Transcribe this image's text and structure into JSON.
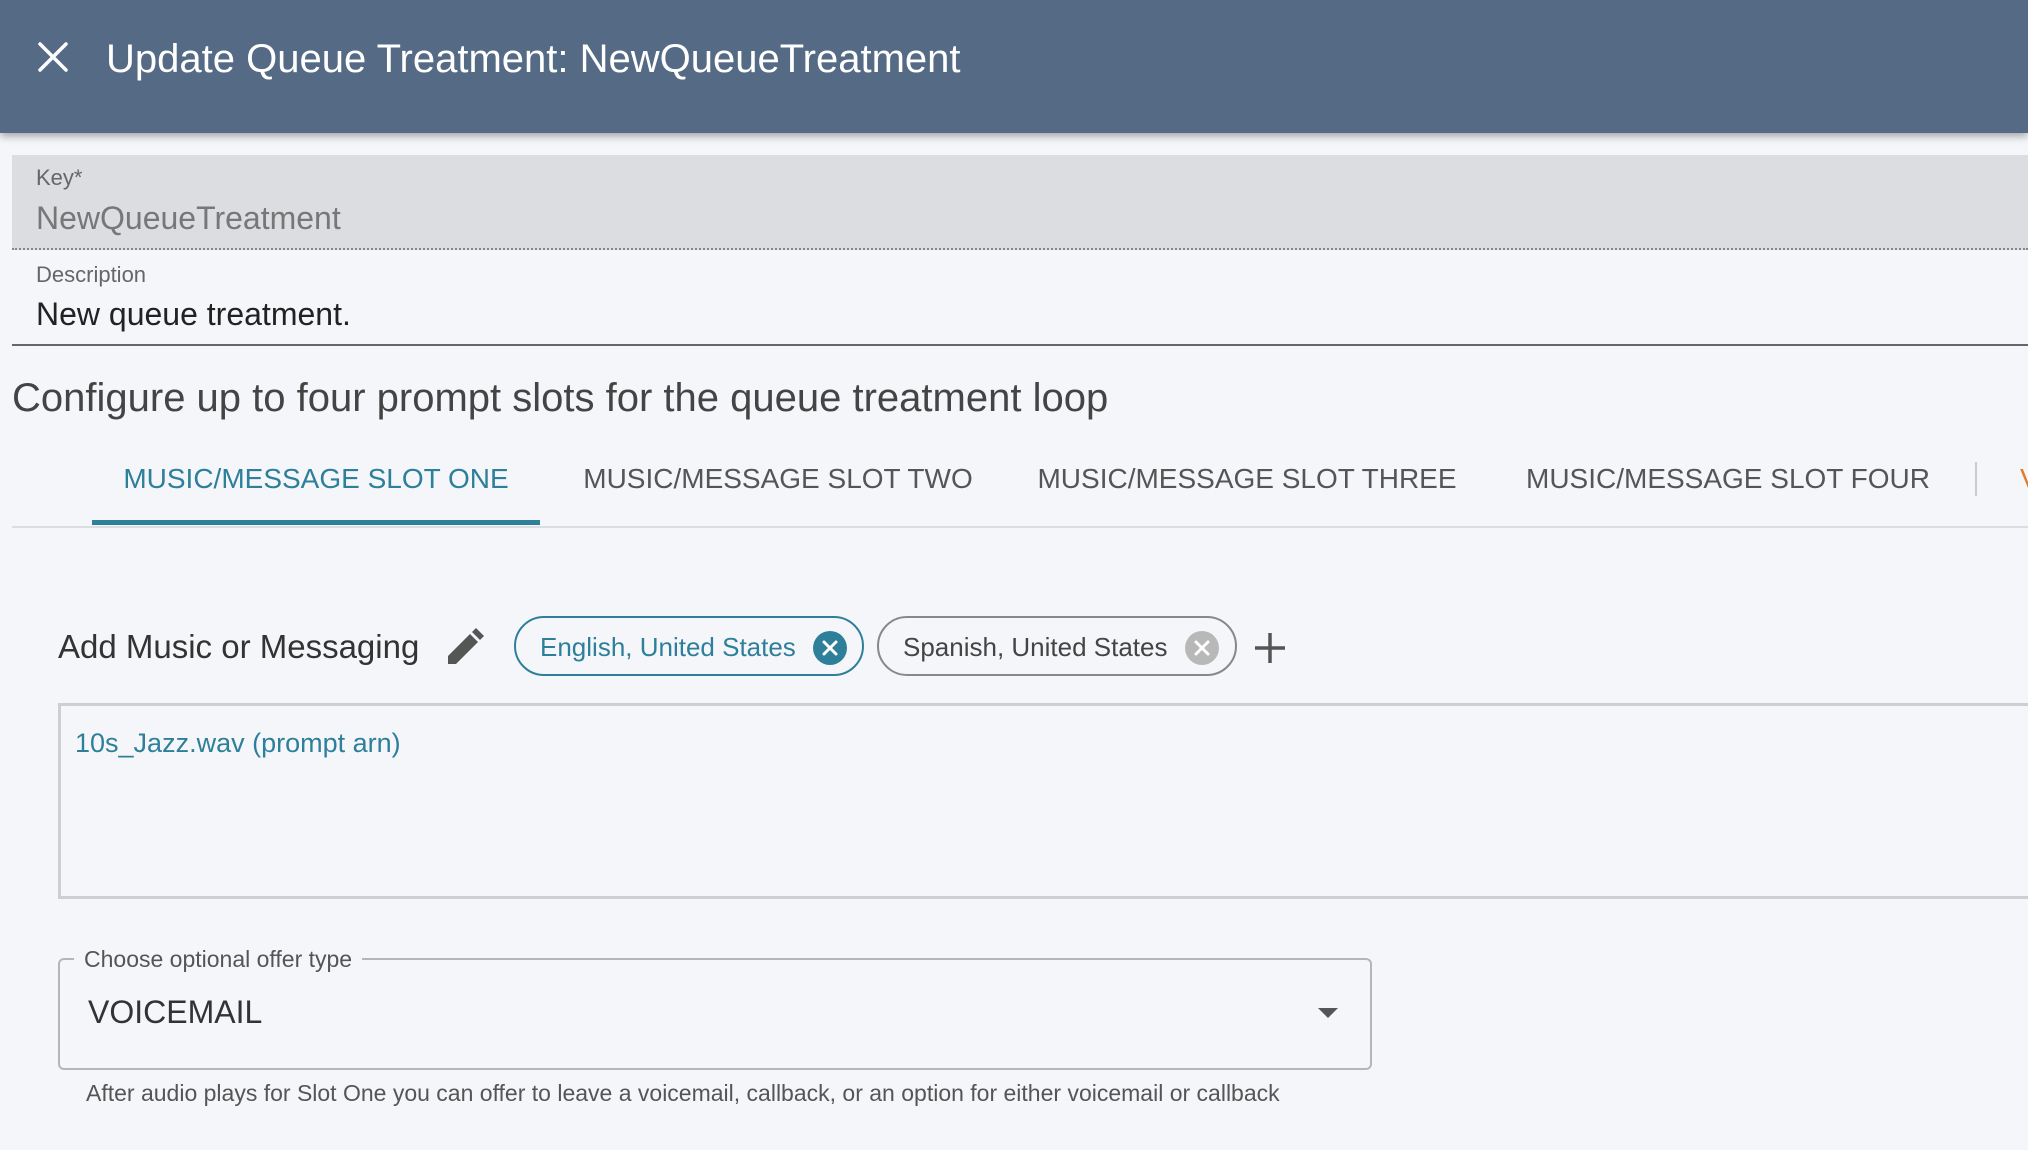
{
  "header": {
    "title": "Update Queue Treatment: NewQueueTreatment",
    "close_icon": "close-icon",
    "background_color": "#546a85"
  },
  "form": {
    "key": {
      "label": "Key*",
      "value": "NewQueueTreatment",
      "disabled": true
    },
    "description": {
      "label": "Description",
      "value": "New queue treatment."
    }
  },
  "section_title": "Configure up to four prompt slots for the queue treatment loop",
  "tabs": [
    {
      "label": "MUSIC/MESSAGE SLOT ONE",
      "active": true
    },
    {
      "label": "MUSIC/MESSAGE SLOT TWO",
      "active": false
    },
    {
      "label": "MUSIC/MESSAGE SLOT THREE",
      "active": false
    },
    {
      "label": "MUSIC/MESSAGE SLOT FOUR",
      "active": false
    }
  ],
  "tab_overflow_text": "V",
  "slot": {
    "add_label": "Add Music or Messaging",
    "edit_icon": "pencil-icon",
    "languages": [
      {
        "label": "English, United States",
        "selected": true
      },
      {
        "label": "Spanish, United States",
        "selected": false
      }
    ],
    "add_icon": "plus-icon",
    "prompt": "10s_Jazz.wav (prompt arn)",
    "offer_type": {
      "label": "Choose optional offer type",
      "value": "VOICEMAIL",
      "helper": "After audio plays for Slot One you can offer to leave a voicemail, callback, or an option for either voicemail or callback"
    }
  },
  "colors": {
    "accent": "#2e7f9a",
    "overflow_accent": "#e07a2e"
  }
}
